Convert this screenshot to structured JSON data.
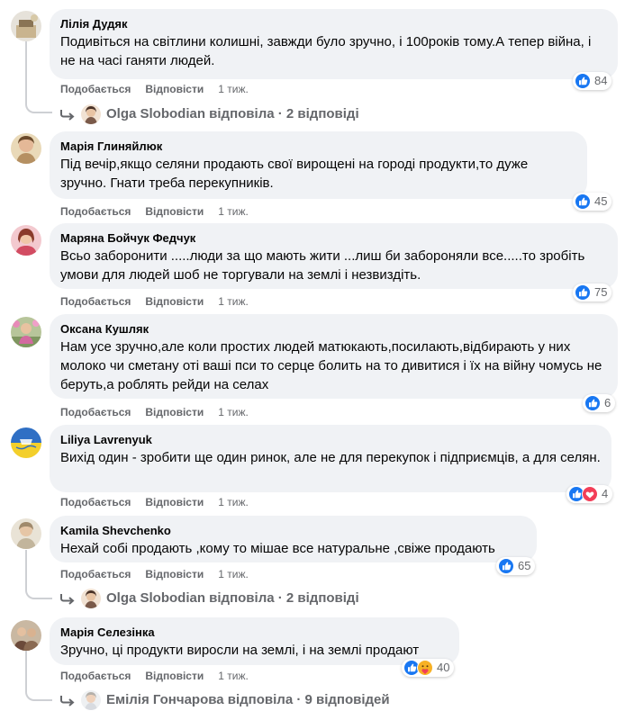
{
  "labels": {
    "like": "Подобається",
    "reply": "Відповісти"
  },
  "colors": {
    "like_blue": "#1877f2",
    "love_red": "#f33e58",
    "care_yellow": "#f7b125",
    "bubble_bg": "#f0f2f5",
    "meta_gray": "#65676b"
  },
  "comments": [
    {
      "author": "Лілія Дудяк",
      "text": "Подивіться на світлини колишні, завжди було зручно, і 100років тому.А тепер війна, і не на часі ганяти людей.",
      "time": "1 тиж.",
      "reactions": {
        "icons": [
          "like"
        ],
        "count": "84"
      },
      "replies": {
        "name": "Olga Slobodian",
        "verb": "відповіла",
        "count_text": "2 відповіді",
        "text": "Olga Slobodian відповіла · 2 відповіді"
      }
    },
    {
      "author": "Марія Глиняйлюк",
      "text": "Під вечір,якщо селяни продають свої вирощені на городі продукти,то дуже зручно. Гнати треба перекупників.",
      "time": "1 тиж.",
      "reactions": {
        "icons": [
          "like"
        ],
        "count": "45"
      }
    },
    {
      "author": "Маряна Бойчук Федчук",
      "text": "Всьо заборонити .....люди за що мають жити ...лиш би забороняли все.....то зробіть умови для людей шоб не торгували на землі і незвиздіть.",
      "time": "1 тиж.",
      "reactions": {
        "icons": [
          "like"
        ],
        "count": "75"
      }
    },
    {
      "author": "Оксана Кушляк",
      "text": "Нам усе зручно,але коли простих людей матюкають,посилають,відбирають у них молоко чи сметану оті ваші пси то серце болить на то дивитися і їх на війну чомусь не беруть,а роблять рейди на селах",
      "time": "1 тиж.",
      "reactions": {
        "icons": [
          "like"
        ],
        "count": "6"
      }
    },
    {
      "author": "Liliya Lavrenyuk",
      "text": "Вихід один - зробити ще один ринок, але не для перекупок і підприємців, а для селян.",
      "time": "1 тиж.",
      "reactions": {
        "icons": [
          "like",
          "love"
        ],
        "count": "4"
      }
    },
    {
      "author": "Kamila Shevchenko",
      "text": "Нехай собі продають ,кому то мішае все натуральне ,свіже продають",
      "time": "1 тиж.",
      "reactions": {
        "icons": [
          "like"
        ],
        "count": "65"
      },
      "replies": {
        "name": "Olga Slobodian",
        "verb": "відповіла",
        "count_text": "2 відповіді",
        "text": "Olga Slobodian відповіла · 2 відповіді"
      }
    },
    {
      "author": "Марія Селезінка",
      "text": "Зручно, ці продукти виросли на землі, і на землі продают",
      "time": "1 тиж.",
      "reactions": {
        "icons": [
          "like",
          "care"
        ],
        "count": "40"
      },
      "replies": {
        "name": "Емілія Гончарова",
        "verb": "відповіла",
        "count_text": "9 відповідей",
        "text": "Емілія Гончарова відповіла · 9 відповідей"
      }
    }
  ]
}
